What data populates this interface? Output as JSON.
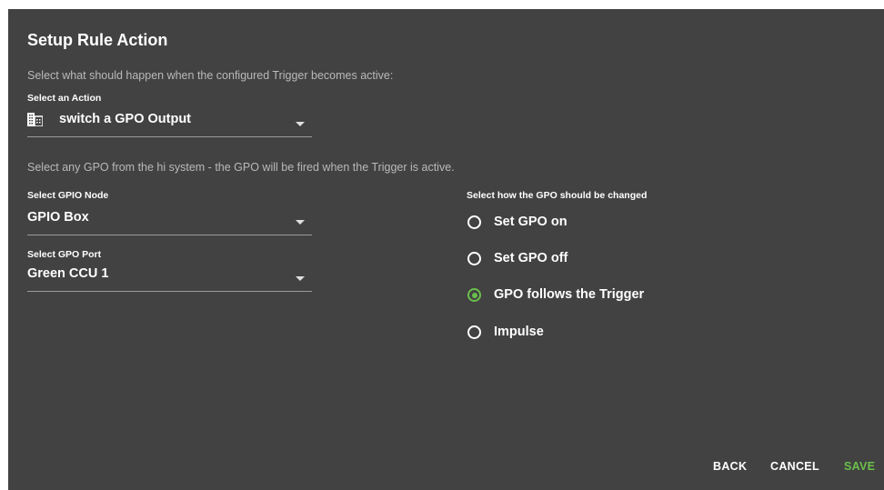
{
  "dialog": {
    "title": "Setup Rule Action",
    "action_hint": "Select what should happen when the configured Trigger becomes active:",
    "action_label": "Select an Action",
    "action_value": "switch a GPO Output",
    "action_icon": "building-icon",
    "gpo_hint": "Select any GPO from the hi system - the GPO will be fired when the Trigger is active.",
    "node_label": "Select GPIO Node",
    "node_value": "GPIO Box",
    "port_label": "Select GPO Port",
    "port_value": "Green CCU 1",
    "change_label": "Select how the GPO should be changed",
    "options": [
      {
        "label": "Set GPO on",
        "checked": false
      },
      {
        "label": "Set GPO off",
        "checked": false
      },
      {
        "label": "GPO follows the Trigger",
        "checked": true
      },
      {
        "label": "Impulse",
        "checked": false
      }
    ]
  },
  "buttons": {
    "back": "BACK",
    "cancel": "CANCEL",
    "save": "SAVE"
  },
  "colors": {
    "background": "#424242",
    "accent": "#6abf4b",
    "hint_text": "#b9b9b9"
  }
}
